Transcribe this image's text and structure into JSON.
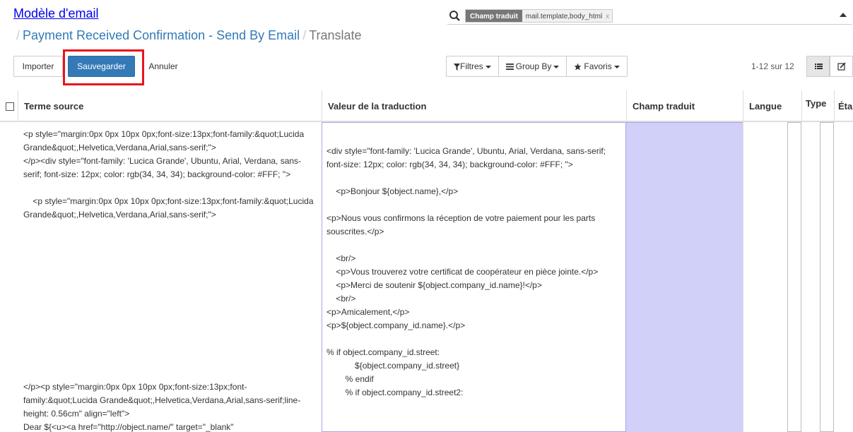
{
  "breadcrumb": {
    "root": "Modèle d'email",
    "record": "Payment Received Confirmation - Send By Email",
    "current": "Translate"
  },
  "search": {
    "facet_label": "Champ traduit",
    "facet_value": "mail.template,body_html",
    "facet_remove": "x"
  },
  "toolbar": {
    "import_label": "Importer",
    "save_label": "Sauvegarder",
    "cancel_label": "Annuler",
    "filters_label": "Filtres",
    "groupby_label": "Group By",
    "favorites_label": "Favoris",
    "pager": "1-12 sur 12"
  },
  "columns": {
    "source": "Terme source",
    "value": "Valeur de la traduction",
    "field": "Champ traduit",
    "lang": "Langue",
    "type": "Type",
    "state": "Éta"
  },
  "row": {
    "source_1": "<p style=\"margin:0px 0px 10px 0px;font-size:13px;font-family:&quot;Lucida Grande&quot;,Helvetica,Verdana,Arial,sans-serif;\">\n</p><div style=\"font-family: 'Lucica Grande', Ubuntu, Arial, Verdana, sans-serif; font-size: 12px; color: rgb(34, 34, 34); background-color: #FFF; \">",
    "source_2": "    <p style=\"margin:0px 0px 10px 0px;font-size:13px;font-family:&quot;Lucida Grande&quot;,Helvetica,Verdana,Arial,sans-serif;\">",
    "source_3": "</p><p style=\"margin:0px 0px 10px 0px;font-size:13px;font-family:&quot;Lucida Grande&quot;,Helvetica,Verdana,Arial,sans-serif;line-height: 0.56cm\" align=\"left\">\nDear ${<u><a href=\"http://object.name/\" target=\"_blank\"",
    "value_1": "<div style=\"font-family: 'Lucica Grande', Ubuntu, Arial, Verdana, sans-serif; font-size: 12px; color: rgb(34, 34, 34); background-color: #FFF; \">",
    "value_2": "    <p>Bonjour ${object.name},</p>",
    "value_3": "<p>Nous vous confirmons la réception de votre paiement pour les parts souscrites.</p>",
    "value_4": "    <br/>\n    <p>Vous trouverez votre certificat de coopérateur en pièce jointe.</p>\n    <p>Merci de soutenir ${object.company_id.name}!</p>\n    <br/>\n<p>Amicalement,</p>\n<p>${object.company_id.name}.</p>",
    "value_5": "% if object.company_id.street:\n            ${object.company_id.street}\n        % endif\n        % if object.company_id.street2:"
  }
}
